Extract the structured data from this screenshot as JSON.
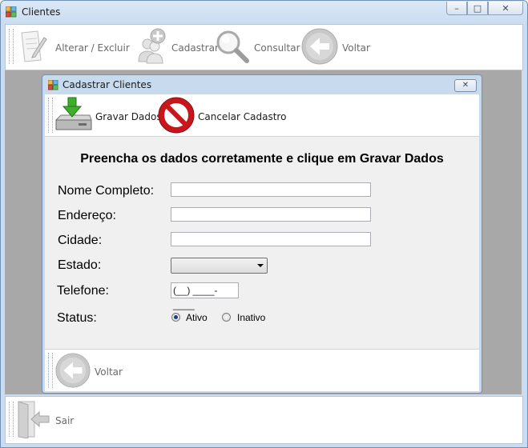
{
  "window": {
    "title": "Clientes",
    "minimize_glyph": "–",
    "maximize_glyph": "□",
    "close_glyph": "✕"
  },
  "toolbar": {
    "items": [
      {
        "label": "Alterar / Excluir",
        "icon": "edit-document-icon"
      },
      {
        "label": "Cadastrar",
        "icon": "add-user-icon"
      },
      {
        "label": "Consultar",
        "icon": "search-icon"
      },
      {
        "label": "Voltar",
        "icon": "back-arrow-icon"
      }
    ]
  },
  "child": {
    "title": "Cadastrar Clientes",
    "close_glyph": "✕",
    "toolbar": {
      "save_label": "Gravar Dados",
      "cancel_label": "Cancelar Cadastro"
    },
    "heading": "Preencha os dados corretamente  e clique em Gravar Dados",
    "form": {
      "name_label": "Nome Completo:",
      "name_value": "",
      "address_label": "Endereço:",
      "address_value": "",
      "city_label": "Cidade:",
      "city_value": "",
      "state_label": "Estado:",
      "state_value": "",
      "phone_label": "Telefone:",
      "phone_mask": "(__) ____-____",
      "status_label": "Status:",
      "status_options": [
        "Ativo",
        "Inativo"
      ],
      "status_selected": "Ativo"
    },
    "bottom": {
      "back_label": "Voltar"
    }
  },
  "bottom_toolbar": {
    "exit_label": "Sair"
  },
  "colors": {
    "frame": "#c9dcf1",
    "mdi_background": "#a8a8a8",
    "form_background": "#f0f0f0",
    "save_green": "#3fae2a",
    "cancel_red": "#c8161d",
    "radio_selected": "#1a3c86"
  }
}
